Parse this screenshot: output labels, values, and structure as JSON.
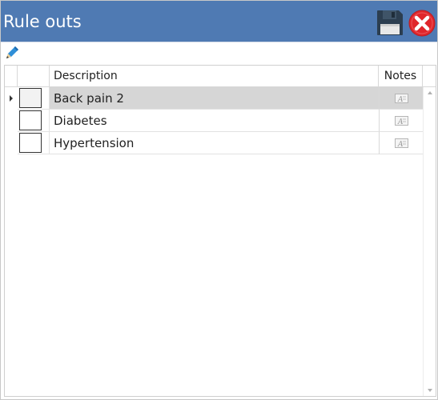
{
  "window": {
    "title": "Rule outs"
  },
  "toolbar": {
    "save_icon": "floppy-disk-icon",
    "close_icon": "close-circle-icon",
    "edit_icon": "pencil-icon"
  },
  "grid": {
    "columns": {
      "description": "Description",
      "notes": "Notes"
    },
    "rows": [
      {
        "description": "Back pain 2",
        "checked": false,
        "selected": true
      },
      {
        "description": "Diabetes",
        "checked": false,
        "selected": false
      },
      {
        "description": "Hypertension",
        "checked": false,
        "selected": false
      }
    ]
  },
  "colors": {
    "title_bar": "#4f7ab3",
    "selected_row": "#d6d6d6",
    "close_red": "#e0262b"
  }
}
